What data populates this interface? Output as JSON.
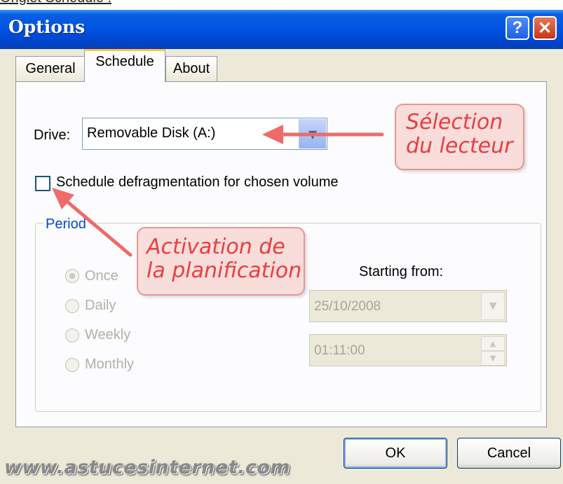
{
  "page_caption": "Onglet Schedule :",
  "window": {
    "title": "Options",
    "help_label": "?",
    "close_label": "✕"
  },
  "tabs": [
    {
      "label": "General",
      "selected": false
    },
    {
      "label": "Schedule",
      "selected": true
    },
    {
      "label": "About",
      "selected": false
    }
  ],
  "drive": {
    "label": "Drive:",
    "value": "Removable Disk (A:)",
    "arrow": "▼"
  },
  "schedule_checkbox": {
    "label": "Schedule defragmentation for chosen volume",
    "checked": false
  },
  "period": {
    "label": "Period",
    "options": [
      {
        "label": "Once",
        "selected": true
      },
      {
        "label": "Daily",
        "selected": false
      },
      {
        "label": "Weekly",
        "selected": false
      },
      {
        "label": "Monthly",
        "selected": false
      }
    ]
  },
  "starting_from": {
    "label": "Starting from:",
    "date": "25/10/2008",
    "time": "01:11:00",
    "date_arrow": "▼",
    "spin_up": "▲",
    "spin_down": "▼"
  },
  "buttons": {
    "ok": "OK",
    "cancel": "Cancel"
  },
  "annotations": {
    "drive_callout_line1": "Sélection",
    "drive_callout_line2": "du lecteur",
    "schedule_callout_line1": "Activation de",
    "schedule_callout_line2": "la planification",
    "arrow_color": "#f06a6a"
  },
  "watermark": "www.astucesinternet.com",
  "colors": {
    "titlebar": "#0055e5",
    "period_label": "#0046d5",
    "callout_text": "#e83f3f",
    "callout_bg": "#f9dddb"
  }
}
